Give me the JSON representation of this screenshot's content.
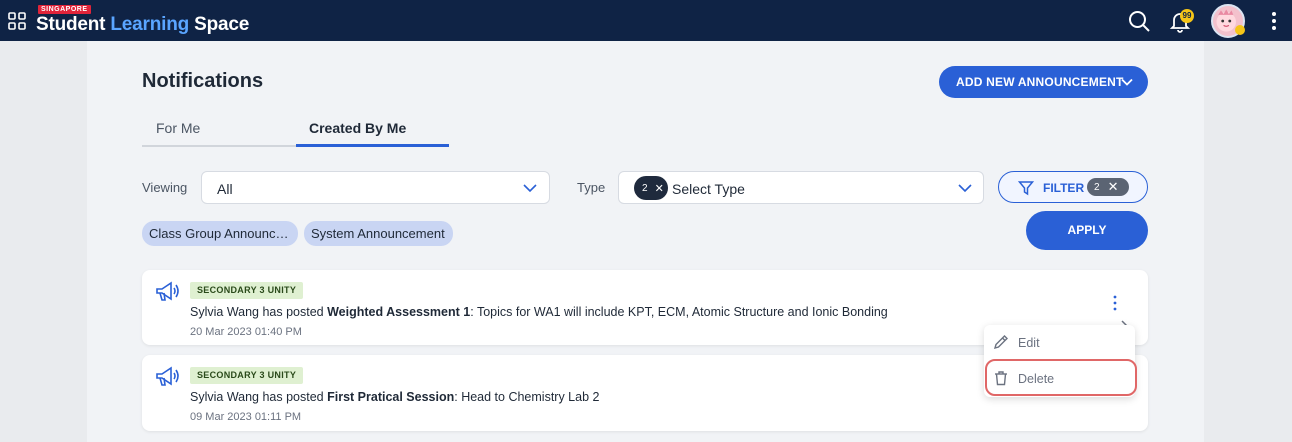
{
  "app": {
    "logo_country": "SINGAPORE",
    "logo_word1": "Student",
    "logo_word2": "Learning",
    "logo_word3": "Space",
    "notification_count": "99",
    "accent_color": "#2a60d6",
    "navbar_color": "#0f2345"
  },
  "page": {
    "title": "Notifications",
    "add_button_label": "ADD NEW ANNOUNCEMENT"
  },
  "tabs": [
    {
      "label": "For Me",
      "active": false
    },
    {
      "label": "Created By Me",
      "active": true
    }
  ],
  "filters": {
    "viewing_label": "Viewing",
    "viewing_value": "All",
    "type_label": "Type",
    "type_placeholder": "Select Type",
    "type_selected_count": "2",
    "filter_button_label": "FILTER",
    "filter_count": "2",
    "apply_label": "APPLY",
    "chips": [
      "Class Group Announc…",
      "System Announcement"
    ]
  },
  "notifications": [
    {
      "group": "SECONDARY 3 UNITY",
      "prefix": "Sylvia Wang has posted ",
      "title": "Weighted Assessment 1",
      "detail": ": Topics for WA1 will include KPT, ECM, Atomic Structure and Ionic Bonding",
      "date": "20 Mar 2023 01:40 PM"
    },
    {
      "group": "SECONDARY 3 UNITY",
      "prefix": "Sylvia Wang has posted ",
      "title": "First Pratical Session",
      "detail": ": Head to Chemistry Lab 2",
      "date": "09 Mar 2023 01:11 PM"
    }
  ],
  "context_menu": {
    "edit_label": "Edit",
    "delete_label": "Delete",
    "highlight_color": "#e06767"
  }
}
